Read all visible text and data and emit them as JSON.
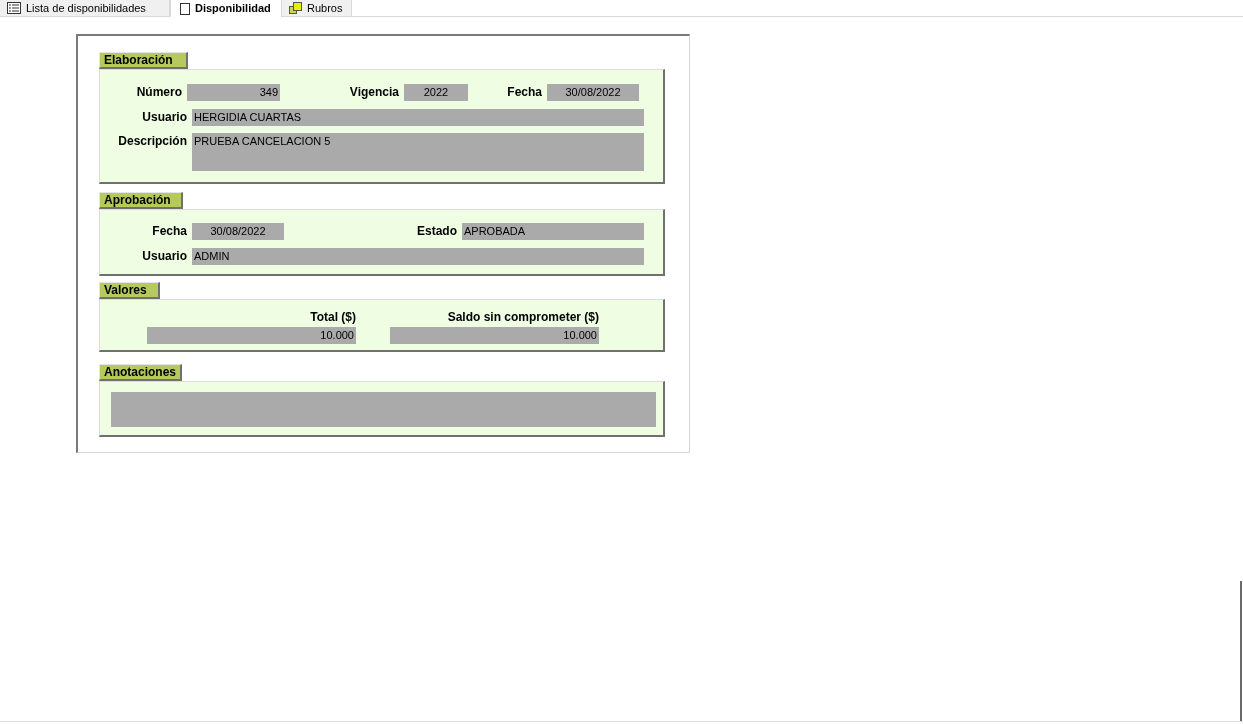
{
  "tabs": [
    {
      "label": "Lista de disponibilidades",
      "selected": false
    },
    {
      "label": "Disponibilidad",
      "selected": true
    },
    {
      "label": "Rubros",
      "selected": false
    }
  ],
  "elaboracion": {
    "title": "Elaboración",
    "numero": {
      "label": "Número",
      "value": "349"
    },
    "vigencia": {
      "label": "Vigencia",
      "value": "2022"
    },
    "fecha": {
      "label": "Fecha",
      "value": "30/08/2022"
    },
    "usuario": {
      "label": "Usuario",
      "value": "HERGIDIA CUARTAS"
    },
    "descripcion": {
      "label": "Descripción",
      "value": "PRUEBA CANCELACION 5"
    }
  },
  "aprobacion": {
    "title": "Aprobación",
    "fecha": {
      "label": "Fecha",
      "value": "30/08/2022"
    },
    "estado": {
      "label": "Estado",
      "value": "APROBADA"
    },
    "usuario": {
      "label": "Usuario",
      "value": "ADMIN"
    }
  },
  "valores": {
    "title": "Valores",
    "total": {
      "label": "Total ($)",
      "value": "10.000"
    },
    "saldo_sin_comprometer": {
      "label": "Saldo sin comprometer ($)",
      "value": "10.000"
    }
  },
  "anotaciones": {
    "title": "Anotaciones"
  }
}
